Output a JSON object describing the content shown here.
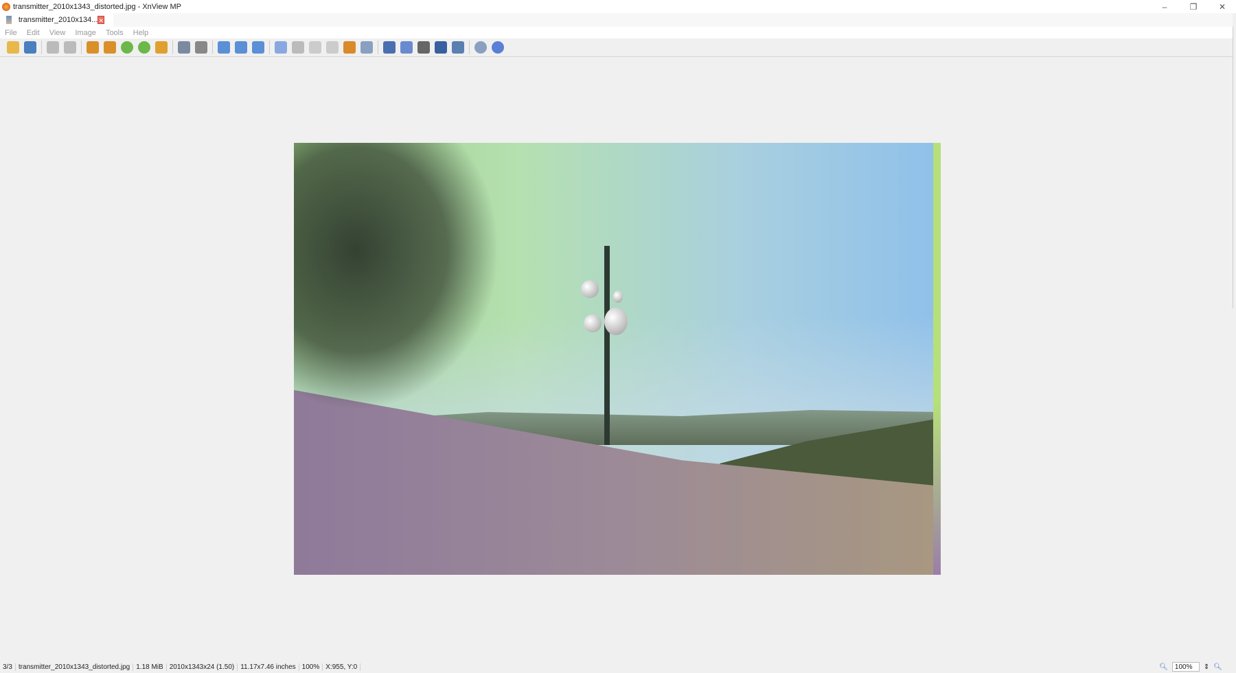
{
  "window": {
    "title": "transmitter_2010x1343_distorted.jpg - XnView MP",
    "minimize": "–",
    "restore": "❐",
    "close": "✕"
  },
  "tab": {
    "label": "transmitter_2010x134...",
    "close": "✕"
  },
  "menu": [
    "File",
    "Edit",
    "View",
    "Image",
    "Tools",
    "Help"
  ],
  "toolbar": [
    "open-folder",
    "save",
    "undo",
    "redo",
    "crop",
    "resize",
    "rotate-left",
    "rotate-right",
    "transform",
    "adjust-colors",
    "levels",
    "zoom-in",
    "zoom-1to1",
    "zoom-out",
    "previous",
    "next",
    "first",
    "last",
    "slideshow",
    "properties",
    "fullscreen",
    "edit-text",
    "print",
    "scan",
    "capture",
    "settings",
    "help"
  ],
  "status": {
    "index": "3/3",
    "filename": "transmitter_2010x1343_distorted.jpg",
    "size": "1.18 MiB",
    "dimensions": "2010x1343x24 (1.50)",
    "print_size": "11.17x7.46 inches",
    "zoom": "100%",
    "coords": "X:955, Y:0"
  },
  "zoom_control": {
    "value": "100%"
  }
}
